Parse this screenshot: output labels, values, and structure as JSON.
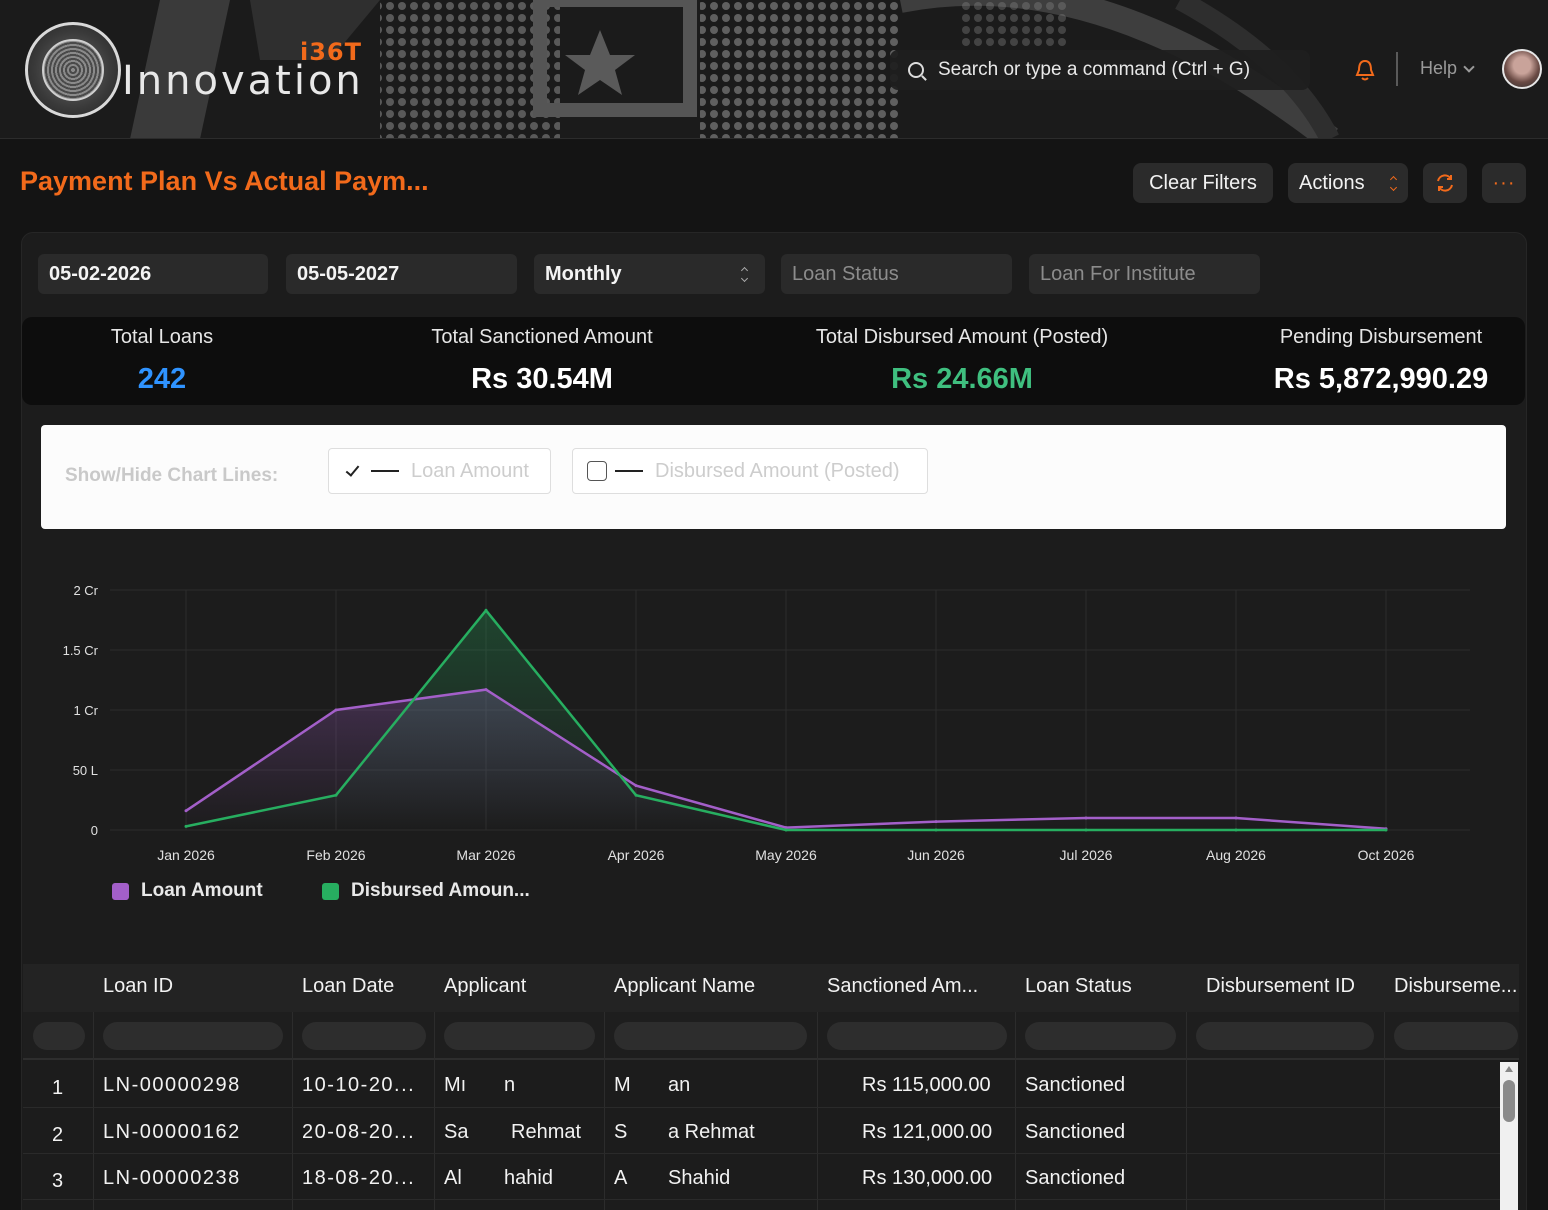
{
  "header": {
    "logo_text": "Innovation",
    "logo_badge": "i36T",
    "logo_seal_text": "INNOVATION i36T",
    "search_placeholder": "Search or type a command (Ctrl + G)",
    "help_label": "Help",
    "accent_color": "#f26a1b"
  },
  "page": {
    "title": "Payment Plan Vs Actual Paym...",
    "clear_filters": "Clear Filters",
    "actions": "Actions",
    "refresh_icon": "refresh-icon",
    "more_label": "···"
  },
  "filters": {
    "from_date": "05-02-2026",
    "to_date": "05-05-2027",
    "period": "Monthly",
    "loan_status_placeholder": "Loan Status",
    "institute_placeholder": "Loan For Institute"
  },
  "kpis": [
    {
      "label": "Total Loans",
      "value": "242",
      "color": "#2f93ff"
    },
    {
      "label": "Total Sanctioned Amount",
      "value": "Rs 30.54M",
      "color": "#ffffff"
    },
    {
      "label": "Total Disbursed Amount (Posted)",
      "value": "Rs 24.66M",
      "color": "#3fbf7f"
    },
    {
      "label": "Pending Disbursement",
      "value": "Rs 5,872,990.29",
      "color": "#ffffff"
    }
  ],
  "chart_toggles": {
    "label": "Show/Hide Chart Lines:",
    "loan_amount": {
      "label": "Loan Amount",
      "checked": true
    },
    "disbursed_amount": {
      "label": "Disbursed Amount (Posted)",
      "checked": false
    }
  },
  "chart_data": {
    "type": "line",
    "categories": [
      "Jan 2026",
      "Feb 2026",
      "Mar 2026",
      "Apr 2026",
      "May 2026",
      "Jun 2026",
      "Jul 2026",
      "Aug 2026",
      "Oct 2026"
    ],
    "y_ticks": [
      "0",
      "50 L",
      "1 Cr",
      "1.5 Cr",
      "2 Cr"
    ],
    "ylim": [
      0,
      2
    ],
    "y_unit": "Cr",
    "grid": true,
    "legend_position": "bottom-left",
    "series": [
      {
        "name": "Loan Amount",
        "color": "#a35fc9",
        "values": [
          0.16,
          1.0,
          1.17,
          0.37,
          0.02,
          0.07,
          0.1,
          0.1,
          0.01
        ]
      },
      {
        "name": "Disbursed Amoun...",
        "color": "#27ae60",
        "values": [
          0.03,
          0.29,
          1.83,
          0.29,
          0.0,
          0.0,
          0.0,
          0.0,
          0.0
        ]
      }
    ]
  },
  "table": {
    "columns": [
      "Loan ID",
      "Loan Date",
      "Applicant",
      "Applicant Name",
      "Sanctioned Am...",
      "Loan Status",
      "Disbursement ID",
      "Disburseme..."
    ],
    "rows": [
      {
        "n": "1",
        "loan_id": "LN-00000298",
        "loan_date": "10-10-20...",
        "applicant_a": "Mı",
        "applicant_b": "n",
        "name_a": "M",
        "name_b": "an",
        "amount": "Rs 115,000.00",
        "status": "Sanctioned"
      },
      {
        "n": "2",
        "loan_id": "LN-00000162",
        "loan_date": "20-08-20...",
        "applicant_a": "Sa",
        "applicant_b": "Rehmat",
        "name_a": "S",
        "name_b": "a Rehmat",
        "amount": "Rs 121,000.00",
        "status": "Sanctioned"
      },
      {
        "n": "3",
        "loan_id": "LN-00000238",
        "loan_date": "18-08-20...",
        "applicant_a": "Al",
        "applicant_b": "hahid",
        "name_a": "A",
        "name_b": "Shahid",
        "amount": "Rs 130,000.00",
        "status": "Sanctioned"
      }
    ]
  }
}
